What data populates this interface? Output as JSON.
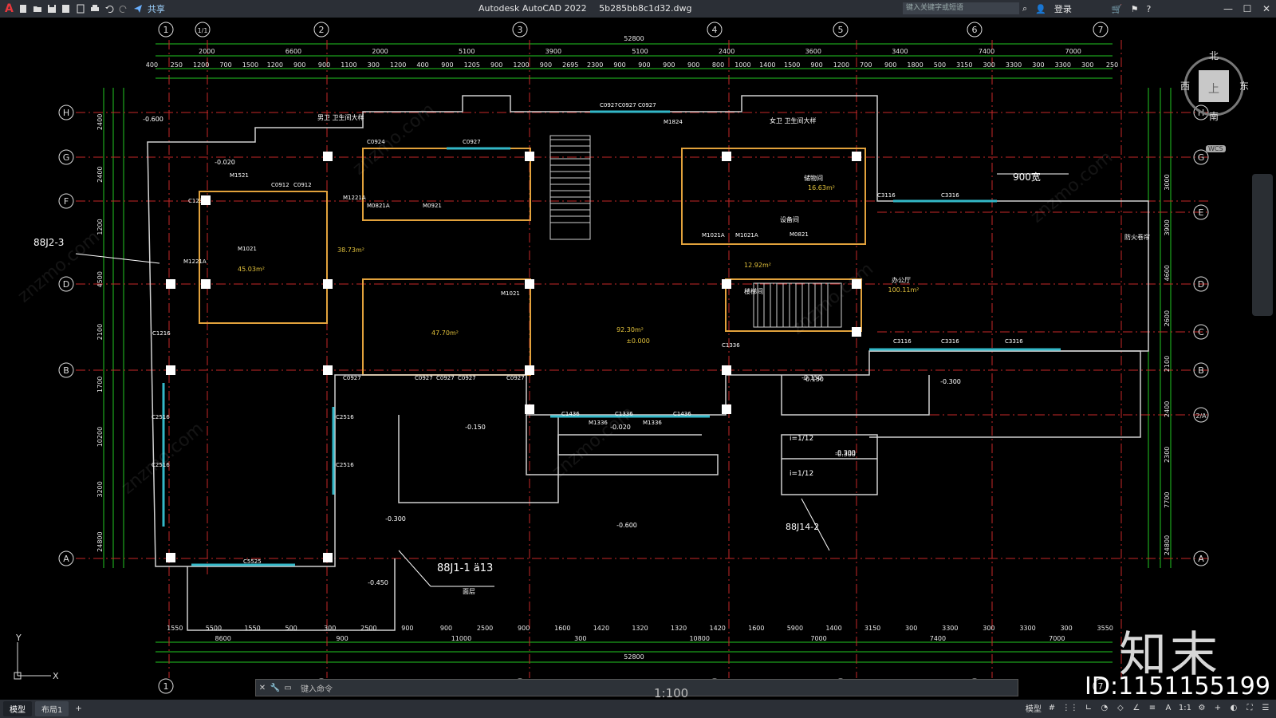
{
  "app": {
    "logo": "A",
    "title": "Autodesk AutoCAD 2022",
    "filename": "5b285bb8c1d32.dwg",
    "share": "共享",
    "search_placeholder": "键入关键字或短语",
    "login": "登录"
  },
  "quick_access": [
    "new-icon",
    "open-icon",
    "save-icon",
    "saveas-icon",
    "plot-icon",
    "print-icon",
    "undo-icon",
    "redo-icon",
    "share-icon"
  ],
  "compass": {
    "n": "北",
    "s": "南",
    "e": "东",
    "w": "西",
    "top": "上",
    "wcs": "WCS"
  },
  "grid_top": [
    "1",
    "1/1",
    "2",
    "3",
    "4",
    "5",
    "6",
    "7"
  ],
  "grid_bottom": [
    "1",
    "2",
    "3",
    "4",
    "5",
    "6",
    "7"
  ],
  "grid_left": [
    "H",
    "G",
    "F",
    "D",
    "B",
    "A"
  ],
  "grid_right": [
    "H",
    "G",
    "E",
    "D",
    "C",
    "B",
    "2/A",
    "A"
  ],
  "dims_top_total": "52800",
  "dims_top_row1": [
    "2000",
    "6600",
    "2000",
    "5100",
    "3900",
    "5100",
    "2400",
    "3600",
    "3400",
    "7400",
    "7000"
  ],
  "dims_top_row2": [
    "400",
    "250",
    "1200",
    "700",
    "1500",
    "1200",
    "900",
    "900",
    "1100",
    "300",
    "1200",
    "400",
    "900",
    "1205",
    "900",
    "1200",
    "900",
    "2695",
    "2300",
    "900",
    "900",
    "900",
    "900",
    "800",
    "1000",
    "1400",
    "1500",
    "900",
    "1200",
    "700",
    "900",
    "1800",
    "500",
    "3150",
    "300",
    "3300",
    "300",
    "3300",
    "300",
    "250"
  ],
  "dims_bottom_total": "52800",
  "dims_bottom_row1": [
    "8600",
    "900",
    "11000",
    "300",
    "10800",
    "7000",
    "7400",
    "7000"
  ],
  "dims_bottom_row2": [
    "1550",
    "5500",
    "1550",
    "500",
    "300",
    "2500",
    "900",
    "900",
    "2500",
    "900",
    "1600",
    "1420",
    "1320",
    "1320",
    "1420",
    "1600",
    "5900",
    "1400",
    "3150",
    "300",
    "3300",
    "300",
    "3300",
    "300",
    "3550"
  ],
  "dims_left": [
    "2400",
    "2400",
    "1200",
    "4500",
    "2100",
    "1700",
    "10200",
    "3200",
    "24800"
  ],
  "dims_right": [
    "3000",
    "3900",
    "4600",
    "2600",
    "2100",
    "2400",
    "2300",
    "7700",
    "24800"
  ],
  "room_labels": [
    {
      "t": "45.03m²"
    },
    {
      "t": "38.73m²"
    },
    {
      "t": "47.70m²"
    },
    {
      "t": "92.30m²"
    },
    {
      "t": "±0.000"
    },
    {
      "t": "12.92m²"
    },
    {
      "t": "16.63m²"
    },
    {
      "t": "100.11m²"
    },
    {
      "t": "办公厅"
    },
    {
      "t": "楼梯间"
    },
    {
      "t": "储物间"
    },
    {
      "t": "设备间"
    }
  ],
  "elevations": [
    "-0.600",
    "-0.020",
    "-0.150",
    "-0.300",
    "-0.150",
    "-0.020",
    "-0.300",
    "-0.300",
    "-0.600",
    "-0.450",
    "-0.150",
    "-0.300"
  ],
  "door_window_tags": [
    "C0927",
    "C0927",
    "C0927",
    "C0927",
    "C0927",
    "C0927",
    "C0927",
    "C0927",
    "C0927",
    "C0924",
    "C0912",
    "C0912",
    "M1521",
    "M1221A",
    "M1221A",
    "M0821A",
    "M0921",
    "M1021",
    "M1021",
    "C1436",
    "C1336",
    "C1436",
    "M1336",
    "M1336",
    "C3116",
    "C3316",
    "C3116",
    "C3316",
    "C3316",
    "C2516",
    "C2516",
    "C2516",
    "C2516",
    "C5525",
    "C1216",
    "C1336",
    "M1021A",
    "M1021A",
    "M0821",
    "C1236",
    "M1824"
  ],
  "annotations": {
    "ref1": "88J2-3",
    "ref2": "88J1-1 ä13",
    "ref3": "88J14-2",
    "wc1": "男卫 卫生间大样",
    "wc2": "女卫 卫生间大样",
    "ramp1": "i=1/12",
    "ramp2": "i=1/12",
    "width_900": "900宽",
    "fire": "防火卷帘",
    "floor": "面层"
  },
  "command": {
    "prompt": "键入命令",
    "scale": "1:100"
  },
  "status": {
    "tabs": [
      "模型",
      "布局1"
    ],
    "model": "模型",
    "ratio": "1:1"
  },
  "watermark": {
    "brand": "知末",
    "id": "ID:1151155199",
    "site": "znzmo.com"
  }
}
